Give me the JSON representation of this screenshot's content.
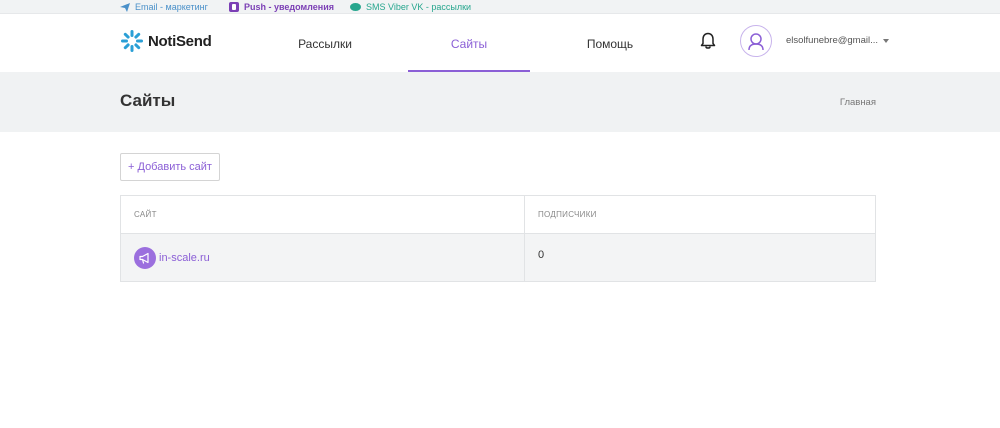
{
  "topbar": {
    "email_label": "Email - маркетинг",
    "push_label": "Push - уведомления",
    "sms_label": "SMS Viber VK - рассылки"
  },
  "header": {
    "logo_text": "NotiSend",
    "nav": {
      "mailings": "Рассылки",
      "sites": "Сайты",
      "help": "Помощь"
    },
    "user_email": "elsolfunebre@gmail..."
  },
  "page": {
    "title": "Сайты",
    "breadcrumb": "Главная",
    "add_button": "+ Добавить сайт"
  },
  "table": {
    "columns": [
      "сайт",
      "подписчики"
    ],
    "rows": [
      {
        "site": "in-scale.ru",
        "subscribers": "0"
      }
    ]
  },
  "colors": {
    "accent": "#8b5fd6",
    "email": "#4a90c9",
    "push": "#7b3fb5",
    "sms": "#27a68e"
  },
  "icons": {
    "email": "paper-plane-icon",
    "push": "push-icon",
    "sms": "chat-bubble-icon",
    "bell": "bell-icon",
    "avatar": "user-icon",
    "site": "megaphone-icon"
  }
}
